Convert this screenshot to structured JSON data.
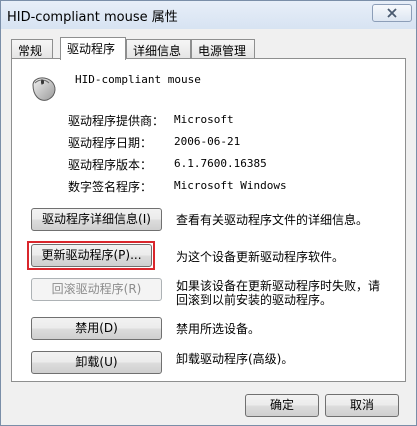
{
  "window": {
    "title": "HID-compliant mouse 属性"
  },
  "tabs": [
    {
      "label": "常规"
    },
    {
      "label": "驱动程序",
      "active": true
    },
    {
      "label": "详细信息"
    },
    {
      "label": "电源管理"
    }
  ],
  "device": {
    "name": "HID-compliant mouse",
    "icon": "mouse-icon"
  },
  "driver_info": [
    {
      "label": "驱动程序提供商：",
      "value": "Microsoft"
    },
    {
      "label": "驱动程序日期：",
      "value": "2006-06-21"
    },
    {
      "label": "驱动程序版本：",
      "value": "6.1.7600.16385"
    },
    {
      "label": "数字签名程序：",
      "value": "Microsoft Windows"
    }
  ],
  "actions": {
    "details": {
      "label": "驱动程序详细信息(I)",
      "desc": "查看有关驱动程序文件的详细信息。"
    },
    "update": {
      "label": "更新驱动程序(P)...",
      "desc": "为这个设备更新驱动程序软件。"
    },
    "rollback": {
      "label": "回滚驱动程序(R)",
      "desc_line1": "如果该设备在更新驱动程序时失败，请",
      "desc_line2": "回滚到以前安装的驱动程序。",
      "disabled": true
    },
    "disable": {
      "label": "禁用(D)",
      "desc": "禁用所选设备。"
    },
    "uninstall": {
      "label": "卸载(U)",
      "desc": "卸载驱动程序(高级)。"
    }
  },
  "footer": {
    "ok": "确定",
    "cancel": "取消"
  },
  "colors": {
    "highlight": "#d9262c",
    "title_bar": "#dbe6f4"
  }
}
